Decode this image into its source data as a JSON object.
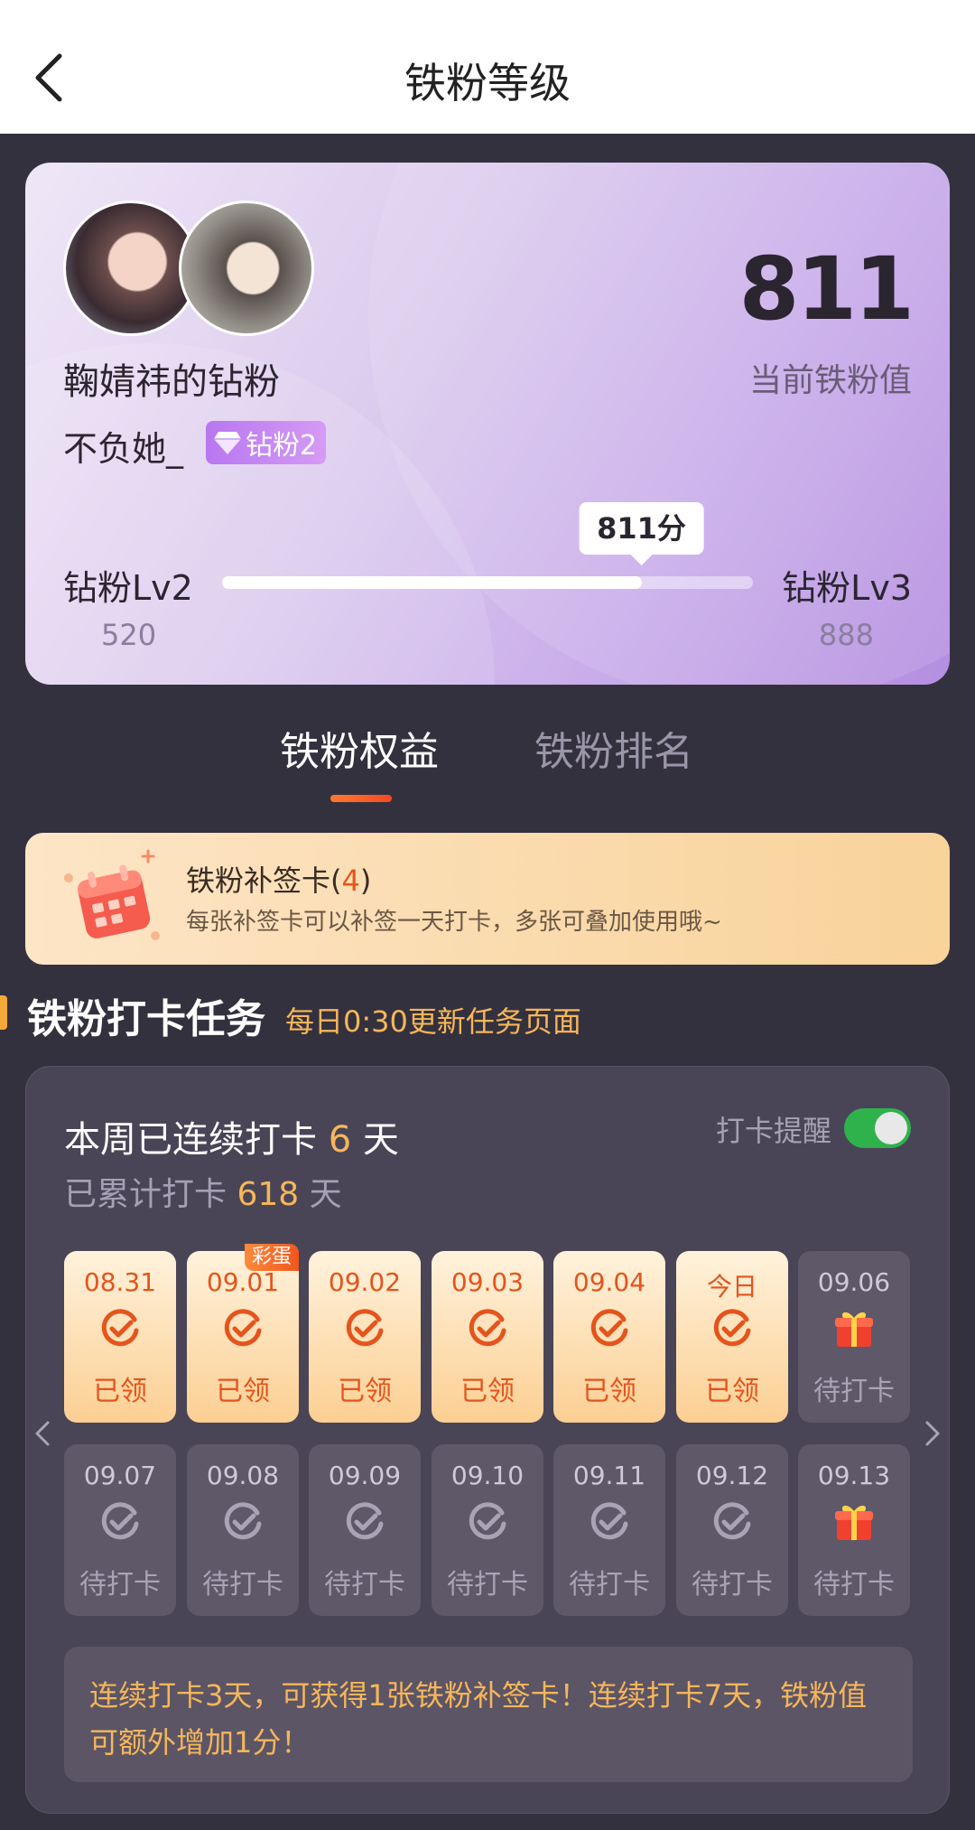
{
  "header": {
    "title": "铁粉等级"
  },
  "level_card": {
    "fan_title": "鞠婧祎的钻粉",
    "user_name": "不负她_",
    "badge_label": "钻粉2",
    "score": "811",
    "score_label": "当前铁粉值",
    "current_level": "钻粉Lv2",
    "current_level_value": "520",
    "next_level": "钻粉Lv3",
    "next_level_value": "888",
    "progress_tip": "811分",
    "progress_fraction": 0.79
  },
  "tabs": [
    {
      "label": "铁粉权益",
      "active": true
    },
    {
      "label": "铁粉排名",
      "active": false
    }
  ],
  "supplement_card": {
    "title_prefix": "铁粉补签卡(",
    "count": "4",
    "title_suffix": ")",
    "description": "每张补签卡可以补签一天打卡，多张可叠加使用哦~"
  },
  "checkin_section": {
    "title": "铁粉打卡任务",
    "subtitle": "每日0:30更新任务页面"
  },
  "task_panel": {
    "streak_prefix": "本周已连续打卡",
    "streak_days": "6",
    "streak_suffix": "天",
    "total_prefix": "已累计打卡",
    "total_days": "618",
    "total_suffix": "天",
    "remind_label": "打卡提醒",
    "remind_on": true,
    "days": [
      {
        "date": "08.31",
        "status": "已领",
        "state": "done"
      },
      {
        "date": "09.01",
        "status": "已领",
        "state": "done",
        "tag": "彩蛋"
      },
      {
        "date": "09.02",
        "status": "已领",
        "state": "done"
      },
      {
        "date": "09.03",
        "status": "已领",
        "state": "done"
      },
      {
        "date": "09.04",
        "status": "已领",
        "state": "done"
      },
      {
        "date": "今日",
        "status": "已领",
        "state": "done"
      },
      {
        "date": "09.06",
        "status": "待打卡",
        "state": "gift"
      },
      {
        "date": "09.07",
        "status": "待打卡",
        "state": "pending"
      },
      {
        "date": "09.08",
        "status": "待打卡",
        "state": "pending"
      },
      {
        "date": "09.09",
        "status": "待打卡",
        "state": "pending"
      },
      {
        "date": "09.10",
        "status": "待打卡",
        "state": "pending"
      },
      {
        "date": "09.11",
        "status": "待打卡",
        "state": "pending"
      },
      {
        "date": "09.12",
        "status": "待打卡",
        "state": "pending"
      },
      {
        "date": "09.13",
        "status": "待打卡",
        "state": "gift"
      }
    ],
    "tip": "连续打卡3天，可获得1张铁粉补签卡！连续打卡7天，铁粉值可额外增加1分！"
  },
  "colors": {
    "accent_orange": "#e4541c",
    "highlight_gold": "#f6b65a",
    "toggle_on": "#2fb24c",
    "badge_purple": "#b877f0"
  }
}
